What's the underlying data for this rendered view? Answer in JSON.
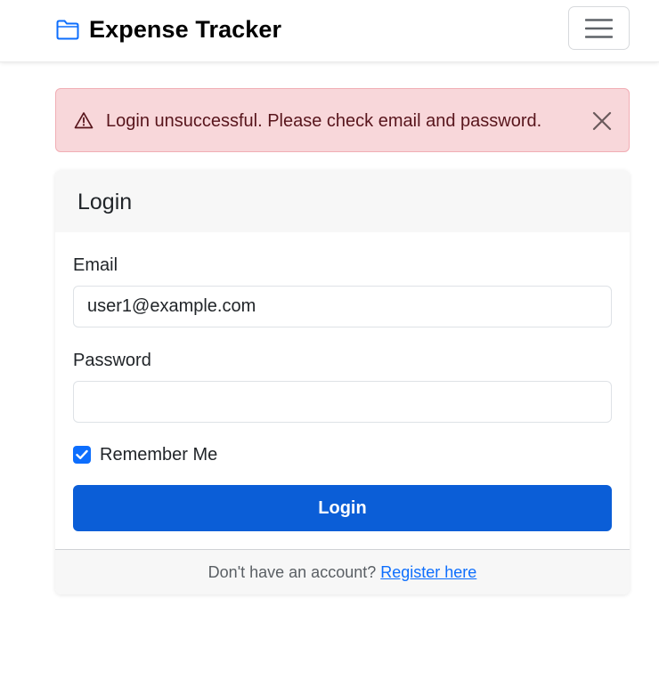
{
  "navbar": {
    "brand": "Expense Tracker",
    "brand_icon": "folder-icon",
    "toggler_icon": "hamburger-menu-icon"
  },
  "alert": {
    "icon": "warning-triangle-icon",
    "message": "Login unsuccessful. Please check email and password.",
    "close_icon": "close-icon"
  },
  "login_card": {
    "title": "Login",
    "email_label": "Email",
    "email_value": "user1@example.com",
    "password_label": "Password",
    "password_value": "",
    "remember_label": "Remember Me",
    "remember_checked": true,
    "submit_label": "Login",
    "footer_text": "Don't have an account?",
    "register_link": "Register here"
  },
  "colors": {
    "primary": "#0b5ed7",
    "alert_background": "#f8d7da",
    "alert_text": "#58151c",
    "card_header_background": "#f7f7f7"
  }
}
